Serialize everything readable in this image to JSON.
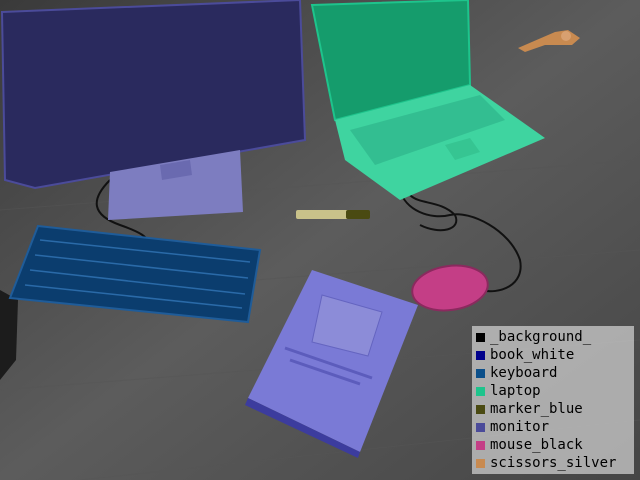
{
  "legend": {
    "items": [
      {
        "label": "_background_",
        "color": "#000000"
      },
      {
        "label": "book_white",
        "color": "#00008b"
      },
      {
        "label": "keyboard",
        "color": "#0b4f8a"
      },
      {
        "label": "laptop",
        "color": "#1ec48c"
      },
      {
        "label": "marker_blue",
        "color": "#4a4a12"
      },
      {
        "label": "monitor",
        "color": "#4b4b9a"
      },
      {
        "label": "mouse_black",
        "color": "#c43e86"
      },
      {
        "label": "scissors_silver",
        "color": "#c88a50"
      }
    ]
  }
}
